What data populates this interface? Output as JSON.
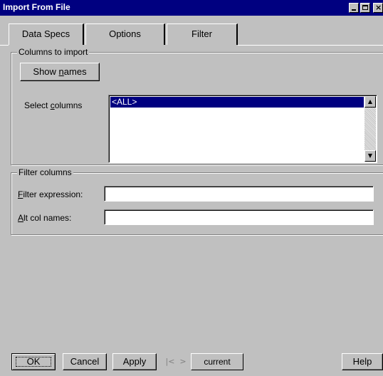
{
  "window": {
    "title": "Import From File"
  },
  "tabs": [
    {
      "label": "Data Specs"
    },
    {
      "label": "Options"
    },
    {
      "label": "Filter"
    }
  ],
  "columns_group": {
    "legend": "Columns to import",
    "show_names_prefix": "Show ",
    "show_names_underline": "n",
    "show_names_suffix": "ames",
    "select_label_prefix": "Select ",
    "select_label_underline": "c",
    "select_label_suffix": "olumns",
    "list_items": [
      "<ALL>"
    ]
  },
  "filter_group": {
    "legend": "Filter columns",
    "filter_expr_underline": "F",
    "filter_expr_suffix": "ilter expression:",
    "filter_expr_value": "",
    "alt_names_underline": "A",
    "alt_names_suffix": "lt col names:",
    "alt_names_value": ""
  },
  "buttons": {
    "ok": "OK",
    "cancel": "Cancel",
    "apply": "Apply",
    "current": "current",
    "help": "Help"
  }
}
